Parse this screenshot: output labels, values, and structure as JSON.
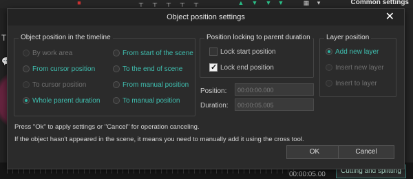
{
  "background": {
    "header_label": "Common settings",
    "timecode": "00:00:05.00",
    "tab_label": "Cutting and splitting"
  },
  "dialog": {
    "title": "Object position settings",
    "close_icon": "close-icon",
    "timeline_group": {
      "legend": "Object position in the timeline",
      "options": [
        {
          "label": "By work area",
          "state": "disabled"
        },
        {
          "label": "From cursor position",
          "state": "enabled"
        },
        {
          "label": "To cursor position",
          "state": "disabled"
        },
        {
          "label": "Whole parent duration",
          "state": "selected"
        },
        {
          "label": "From start of the scene",
          "state": "enabled"
        },
        {
          "label": "To the end of scene",
          "state": "enabled"
        },
        {
          "label": "From manual position",
          "state": "enabled"
        },
        {
          "label": "To manual position",
          "state": "enabled"
        }
      ]
    },
    "locking_group": {
      "legend": "Position locking to parent duration",
      "lock_start": {
        "label": "Lock start position",
        "checked": false
      },
      "lock_end": {
        "label": "Lock end position",
        "checked": true
      }
    },
    "position_field": {
      "label": "Position:",
      "value": "00:00:00.000"
    },
    "duration_field": {
      "label": "Duration:",
      "value": "00:00:05.005"
    },
    "layer_group": {
      "legend": "Layer position",
      "options": [
        {
          "label": "Add new layer",
          "state": "selected"
        },
        {
          "label": "Insert new layer",
          "state": "disabled"
        },
        {
          "label": "Insert to layer",
          "state": "disabled"
        }
      ]
    },
    "message1": "Press \"Ok\" to apply settings or \"Cancel\" for operation canceling.",
    "message2": "If the object hasn't appeared in the scene, it means you need to manually add it using the cross tool.",
    "ok_label": "OK",
    "cancel_label": "Cancel"
  }
}
